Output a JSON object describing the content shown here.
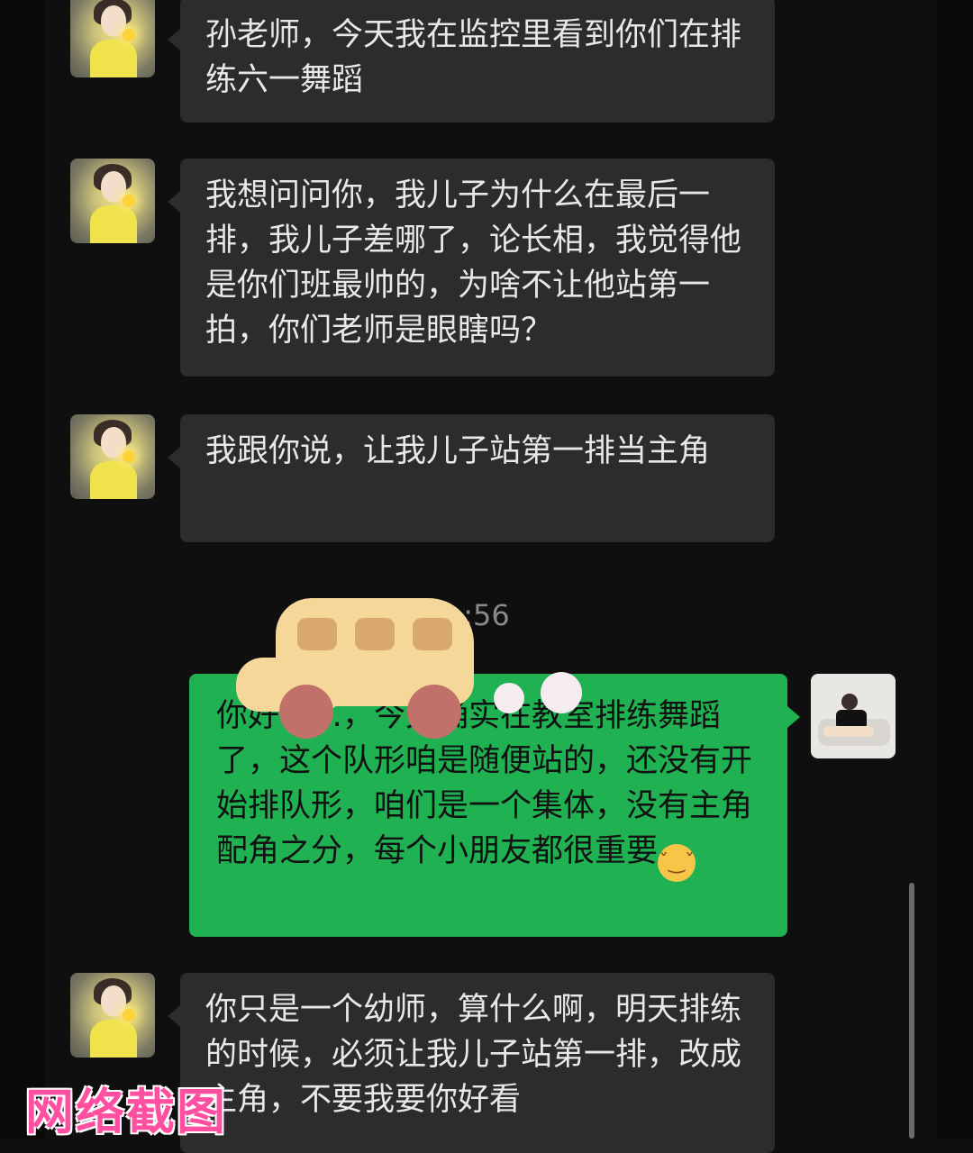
{
  "messages": [
    {
      "sender": "parent",
      "text": "孙老师，今天我在监控里看到你们在排练六一舞蹈"
    },
    {
      "sender": "parent",
      "text": "我想问问你，我儿子为什么在最后一排，我儿子差哪了，论长相，我觉得他是你们班最帅的，为啥不让他站第一拍，你们老师是眼瞎吗？"
    },
    {
      "sender": "parent",
      "text": "我跟你说，让我儿子站第一排当主角"
    },
    {
      "sender": "teacher",
      "text": "你好……，今天确实在教室排练舞蹈了，这个队形咱是随便站的，还没有开始排队形，咱们是一个集体，没有主角配角之分，每个小朋友都很重要"
    },
    {
      "sender": "parent",
      "text": "你只是一个幼师，算什么啊，明天排练的时候，必须让我儿子站第一排，改成主角，不要我要你好看"
    }
  ],
  "timestamp_visible": ":56",
  "teacher_emoji": "😌",
  "watermark": "网络截图",
  "colors": {
    "background": "#0f0f0f",
    "incoming_bubble": "#2c2c2c",
    "outgoing_bubble": "#20b152",
    "watermark": "#ff4fa0"
  },
  "icons": {
    "parent_avatar": "girl-with-flower-avatar",
    "teacher_avatar": "child-on-sofa-avatar",
    "sticker": "cartoon-bus-sticker"
  }
}
